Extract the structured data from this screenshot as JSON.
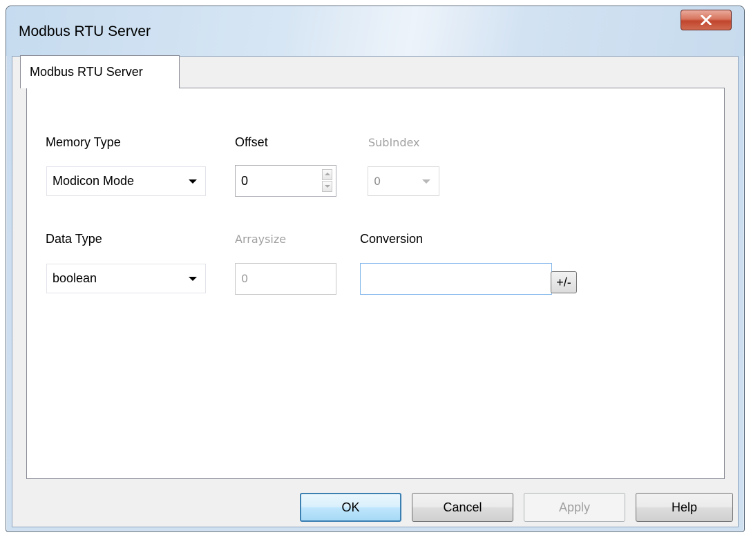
{
  "window": {
    "title": "Modbus RTU Server",
    "close_icon": "close-icon"
  },
  "tabs": [
    {
      "label": "Modbus RTU Server",
      "selected": true
    }
  ],
  "form": {
    "memory_type": {
      "label": "Memory Type",
      "value": "Modicon Mode"
    },
    "offset": {
      "label": "Offset",
      "value": "0"
    },
    "subindex": {
      "label": "SubIndex",
      "value": "0",
      "enabled": false
    },
    "data_type": {
      "label": "Data Type",
      "value": "boolean"
    },
    "arraysize": {
      "label": "Arraysize",
      "value": "0",
      "enabled": false
    },
    "conversion": {
      "label": "Conversion",
      "value": "",
      "sign_button": "+/-"
    }
  },
  "buttons": {
    "ok": "OK",
    "cancel": "Cancel",
    "apply": "Apply",
    "help": "Help"
  }
}
